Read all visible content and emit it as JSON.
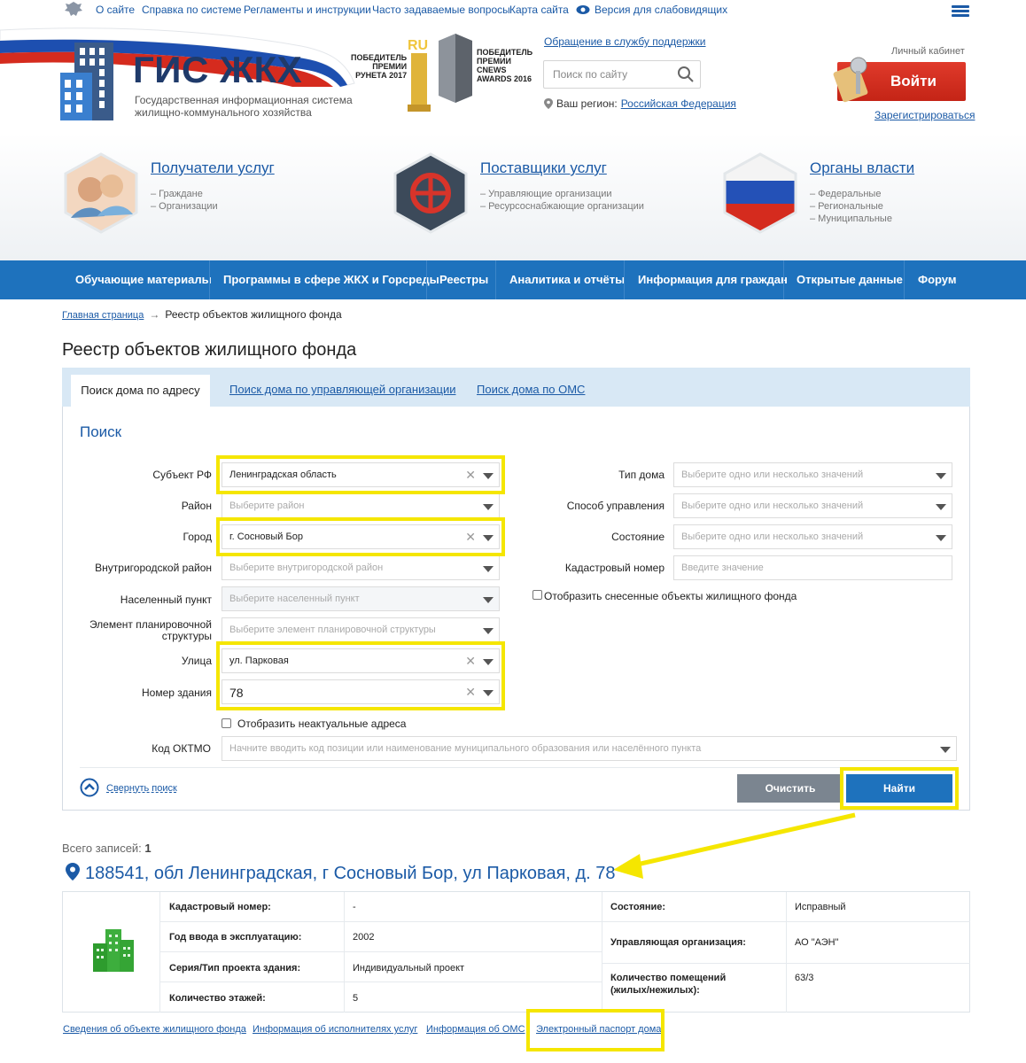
{
  "topnav": {
    "links": [
      "О сайте",
      "Справка по системе",
      "Регламенты и инструкции",
      "Часто задаваемые вопросы",
      "Карта сайта",
      "Версия для слабовидящих"
    ]
  },
  "header": {
    "logo_title": "ГИС ЖКХ",
    "logo_subtitle": "Государственная информационная система жилищно-коммунального хозяйства",
    "award1": "ПОБЕДИТЕЛЬ\nПРЕМИИ\nРУНЕТА 2017",
    "award2": "ПОБЕДИТЕЛЬ\nПРЕМИИ\nCNEWS\nAWARDS 2016",
    "support_link": "Обращение в службу поддержки",
    "search_placeholder": "Поиск по сайту",
    "region_label": "Ваш регион:",
    "region_value": "Российская Федерация",
    "cabinet_label": "Личный кабинет",
    "login_button": "Войти",
    "register_link": "Зарегистрироваться"
  },
  "roles": [
    {
      "title": "Получатели услуг",
      "items": [
        "– Граждане",
        "– Организации"
      ]
    },
    {
      "title": "Поставщики услуг",
      "items": [
        "– Управляющие организации",
        "– Ресурсоснабжающие организации"
      ]
    },
    {
      "title": "Органы власти",
      "items": [
        "– Федеральные",
        "– Региональные",
        "– Муниципальные"
      ]
    }
  ],
  "menu": [
    "Обучающие материалы",
    "Программы в сфере ЖКХ и Горсреды",
    "Реестры",
    "Аналитика и отчёты",
    "Информация для граждан",
    "Открытые данные",
    "Форум"
  ],
  "breadcrumb": {
    "home": "Главная страница",
    "arrow": "→",
    "current": "Реестр объектов жилищного фонда"
  },
  "page_title": "Реестр объектов жилищного фонда",
  "tabs": {
    "active": "Поиск дома по адресу",
    "others": [
      "Поиск дома по управляющей организации",
      "Поиск дома по ОМС"
    ]
  },
  "form": {
    "title": "Поиск",
    "left": [
      {
        "label": "Субъект РФ",
        "value": "Ленинградская область",
        "placeholder": ""
      },
      {
        "label": "Район",
        "value": "",
        "placeholder": "Выберите район"
      },
      {
        "label": "Город",
        "value": "г. Сосновый Бор",
        "placeholder": ""
      },
      {
        "label": "Внутригородской район",
        "value": "",
        "placeholder": "Выберите внутригородской район"
      },
      {
        "label": "Населенный пункт",
        "value": "",
        "placeholder": "Выберите населенный пункт"
      },
      {
        "label": "Элемент планировочной структуры",
        "value": "",
        "placeholder": "Выберите элемент планировочной структуры"
      },
      {
        "label": "Улица",
        "value": "ул. Парковая",
        "placeholder": ""
      },
      {
        "label": "Номер здания",
        "value": "78",
        "placeholder": ""
      }
    ],
    "right": [
      {
        "label": "Тип дома",
        "placeholder": "Выберите одно или несколько значений"
      },
      {
        "label": "Способ управления",
        "placeholder": "Выберите одно или несколько значений"
      },
      {
        "label": "Состояние",
        "placeholder": "Выберите одно или несколько значений"
      },
      {
        "label": "Кадастровый номер",
        "placeholder": "Введите значение"
      }
    ],
    "show_demolished": "Отобразить снесенные объекты жилищного фонда",
    "show_inactual": "Отобразить неактуальные адреса",
    "oktmo_label": "Код ОКТМО",
    "oktmo_placeholder": "Начните вводить код позиции или наименование муниципального образования или населённого пункта",
    "collapse": "Свернуть поиск",
    "clear_button": "Очистить",
    "find_button": "Найти"
  },
  "results": {
    "total_label": "Всего записей:",
    "total_value": "1",
    "address": "188541, обл Ленинградская, г Сосновый Бор, ул Парковая, д. 78",
    "left_fields": [
      {
        "key": "Кадастровый номер:",
        "value": "-"
      },
      {
        "key": "Год ввода в эксплуатацию:",
        "value": "2002"
      },
      {
        "key": "Серия/Тип проекта здания:",
        "value": "Индивидуальный проект"
      },
      {
        "key": "Количество этажей:",
        "value": "5"
      }
    ],
    "right_fields": [
      {
        "key": "Состояние:",
        "value": "Исправный"
      },
      {
        "key": "Управляющая организация:",
        "value": "АО \"АЭН\""
      },
      {
        "key": "Количество помещений (жилых/нежилых):",
        "value": "63/3"
      }
    ],
    "links": [
      "Сведения об объекте жилищного фонда",
      "Информация об исполнителях услуг",
      "Информация об ОМС",
      "Электронный паспорт дома"
    ]
  },
  "colors": {
    "brand_blue": "#1e72bd",
    "highlight": "#f5e600",
    "login_red": "#d32f1f"
  }
}
